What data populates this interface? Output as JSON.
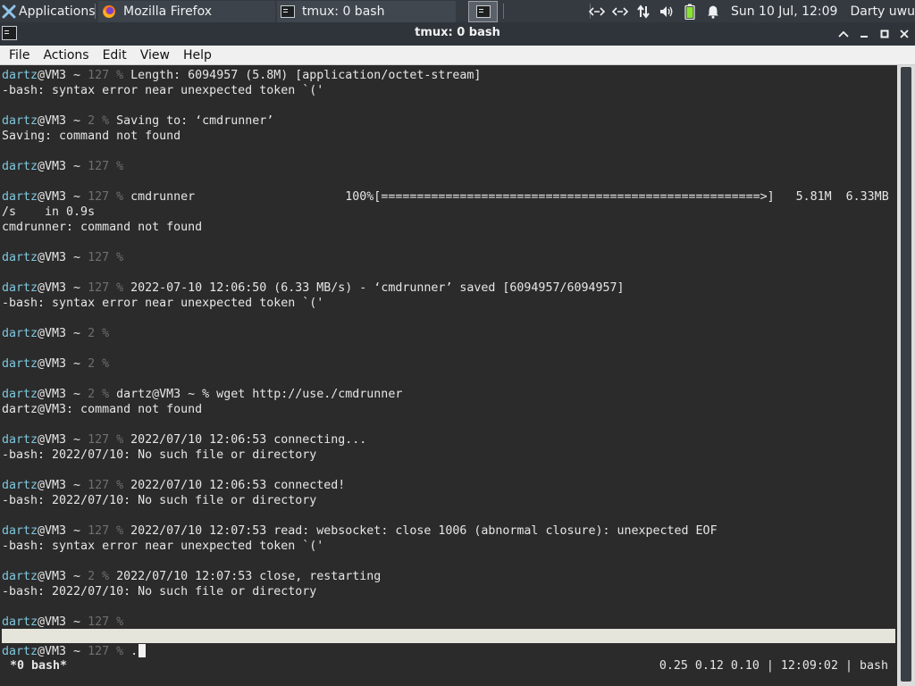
{
  "panel": {
    "applications_label": "Applications",
    "tasks": [
      {
        "label": "Mozilla Firefox",
        "icon": "firefox-icon"
      },
      {
        "label": "tmux: 0 bash",
        "icon": "terminal-icon"
      }
    ],
    "clock": "Sun 10 Jul, 12:09",
    "user": "Darty uwu",
    "tray_icons": [
      "network-icon",
      "network-icon",
      "transfer-icon",
      "volume-icon",
      "battery-icon",
      "notification-bell-icon"
    ]
  },
  "window": {
    "title": "tmux: 0 bash"
  },
  "menu": {
    "file": "File",
    "actions": "Actions",
    "edit": "Edit",
    "view": "View",
    "help": "Help"
  },
  "terminal": {
    "lines": [
      {
        "user": "dartz",
        "host": "@VM3 ~ ",
        "code": "127 ",
        "sym": "% ",
        "cmd": "Length: 6094957 (5.8M) [application/octet-stream]"
      },
      {
        "text": "-bash: syntax error near unexpected token `('"
      },
      {
        "text": ""
      },
      {
        "user": "dartz",
        "host": "@VM3 ~ ",
        "code": "2 ",
        "sym": "% ",
        "cmd": "Saving to: ‘cmdrunner’"
      },
      {
        "text": "Saving: command not found"
      },
      {
        "text": ""
      },
      {
        "user": "dartz",
        "host": "@VM3 ~ ",
        "code": "127 ",
        "sym": "%",
        "cmd": ""
      },
      {
        "text": ""
      },
      {
        "user": "dartz",
        "host": "@VM3 ~ ",
        "code": "127 ",
        "sym": "% ",
        "cmd": "cmdrunner                     100%[=====================================================>]   5.81M  6.33MB"
      },
      {
        "text": "/s    in 0.9s"
      },
      {
        "text": "cmdrunner: command not found"
      },
      {
        "text": ""
      },
      {
        "user": "dartz",
        "host": "@VM3 ~ ",
        "code": "127 ",
        "sym": "%",
        "cmd": ""
      },
      {
        "text": ""
      },
      {
        "user": "dartz",
        "host": "@VM3 ~ ",
        "code": "127 ",
        "sym": "% ",
        "cmd": "2022-07-10 12:06:50 (6.33 MB/s) - ‘cmdrunner’ saved [6094957/6094957]"
      },
      {
        "text": "-bash: syntax error near unexpected token `('"
      },
      {
        "text": ""
      },
      {
        "user": "dartz",
        "host": "@VM3 ~ ",
        "code": "2 ",
        "sym": "%",
        "cmd": ""
      },
      {
        "text": ""
      },
      {
        "user": "dartz",
        "host": "@VM3 ~ ",
        "code": "2 ",
        "sym": "%",
        "cmd": ""
      },
      {
        "text": ""
      },
      {
        "user": "dartz",
        "host": "@VM3 ~ ",
        "code": "2 ",
        "sym": "% ",
        "cmd": "dartz@VM3 ~ % wget http://use./cmdrunner"
      },
      {
        "text": "dartz@VM3: command not found"
      },
      {
        "text": ""
      },
      {
        "user": "dartz",
        "host": "@VM3 ~ ",
        "code": "127 ",
        "sym": "% ",
        "cmd": "2022/07/10 12:06:53 connecting..."
      },
      {
        "text": "-bash: 2022/07/10: No such file or directory"
      },
      {
        "text": ""
      },
      {
        "user": "dartz",
        "host": "@VM3 ~ ",
        "code": "127 ",
        "sym": "% ",
        "cmd": "2022/07/10 12:06:53 connected!"
      },
      {
        "text": "-bash: 2022/07/10: No such file or directory"
      },
      {
        "text": ""
      },
      {
        "user": "dartz",
        "host": "@VM3 ~ ",
        "code": "127 ",
        "sym": "% ",
        "cmd": "2022/07/10 12:07:53 read: websocket: close 1006 (abnormal closure): unexpected EOF"
      },
      {
        "text": "-bash: syntax error near unexpected token `('"
      },
      {
        "text": ""
      },
      {
        "user": "dartz",
        "host": "@VM3 ~ ",
        "code": "2 ",
        "sym": "% ",
        "cmd": "2022/07/10 12:07:53 close, restarting"
      },
      {
        "text": "-bash: 2022/07/10: No such file or directory"
      },
      {
        "text": ""
      },
      {
        "user": "dartz",
        "host": "@VM3 ~ ",
        "code": "127 ",
        "sym": "%",
        "cmd": ""
      }
    ],
    "prompt": {
      "user": "dartz",
      "host": "@VM3 ~ ",
      "code": "127 ",
      "sym": "% ",
      "input": "."
    },
    "status_left": "*0 bash*",
    "status_right": "0.25 0.12 0.10 | 12:09:02 | bash"
  }
}
